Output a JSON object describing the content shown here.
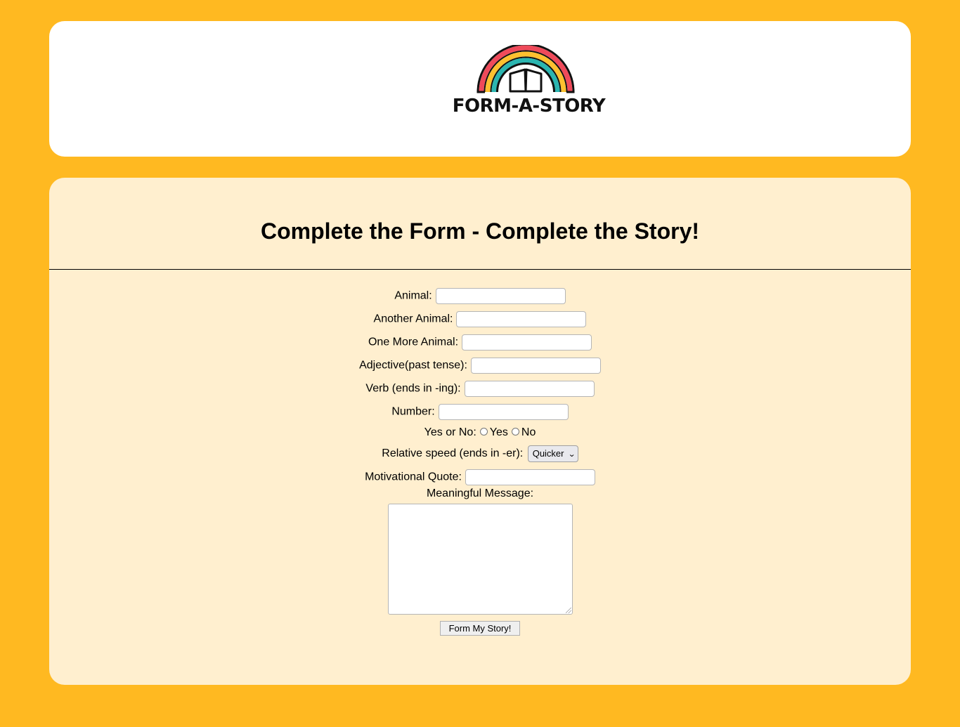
{
  "header": {
    "logo_text": "FORM-A-STORY",
    "logo_icon": "rainbow-book-icon",
    "colors": {
      "rainbow_red": "#ef4a5a",
      "rainbow_yellow": "#fdc02f",
      "rainbow_teal": "#2bb5b0",
      "outline": "#111111"
    }
  },
  "page": {
    "background": "#ffb921",
    "card_background": "#ffefcf",
    "title": "Complete the Form - Complete the Story!"
  },
  "form": {
    "fields": [
      {
        "label": "Animal:",
        "value": ""
      },
      {
        "label": "Another Animal:",
        "value": ""
      },
      {
        "label": "One More Animal:",
        "value": ""
      },
      {
        "label": "Adjective(past tense):",
        "value": ""
      },
      {
        "label": "Verb (ends in -ing):",
        "value": ""
      },
      {
        "label": "Number:",
        "value": ""
      }
    ],
    "yes_no": {
      "label": "Yes or No:",
      "options": [
        "Yes",
        "No"
      ],
      "selected": null
    },
    "speed": {
      "label": "Relative speed (ends in -er):",
      "selected": "Quicker"
    },
    "quote": {
      "label": "Motivational Quote:",
      "value": ""
    },
    "message": {
      "label": "Meaningful Message:",
      "value": ""
    },
    "submit_label": "Form My Story!"
  }
}
